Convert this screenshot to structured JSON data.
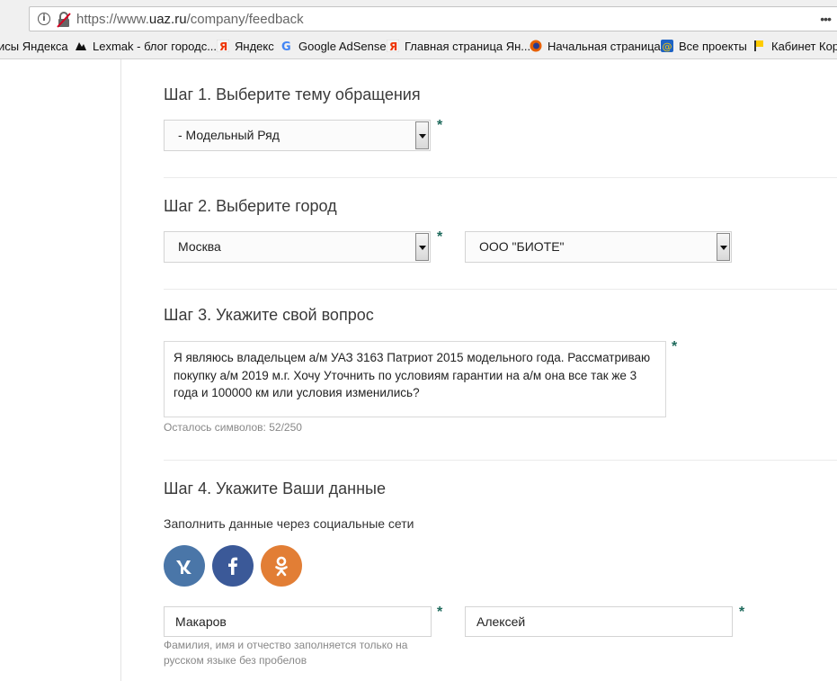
{
  "browser": {
    "url_prefix": "https://www.",
    "url_domain": "uaz.ru",
    "url_path": "/company/feedback",
    "menu_glyph": "•••",
    "bookmarks": [
      {
        "label": "исы Яндекса",
        "icon": "none"
      },
      {
        "label": "Lexmak - блог городс...",
        "icon": "lexmak-icon"
      },
      {
        "label": "Яндекс",
        "icon": "yandex-icon"
      },
      {
        "label": "Google AdSense",
        "icon": "google-icon"
      },
      {
        "label": "Главная страница Ян...",
        "icon": "yandex-icon"
      },
      {
        "label": "Начальная страница",
        "icon": "firefox-icon"
      },
      {
        "label": "Все проекты",
        "icon": "at-icon"
      },
      {
        "label": "Кабинет Корп",
        "icon": "yandex-flag-icon"
      }
    ]
  },
  "step1": {
    "title": "Шаг 1. Выберите тему обращения",
    "topic_select": "- Модельный Ряд",
    "required_mark": "*"
  },
  "step2": {
    "title": "Шаг 2. Выберите город",
    "city_select": "Москва",
    "dealer_select": "ООО \"БИОТЕ\"",
    "required_mark": "*"
  },
  "step3": {
    "title": "Шаг 3. Укажите свой вопрос",
    "question_text": "Я являюсь владельцем а/м УАЗ 3163 Патриот 2015 модельного года. Рассматриваю покупку а/м 2019 м.г. Хочу Уточнить по условиям гарантии на а/м она все так же 3 года и 100000 км или условия изменились?",
    "chars_left": "Осталось символов: 52/250",
    "required_mark": "*"
  },
  "step4": {
    "title": "Шаг 4. Укажите Ваши данные",
    "social_label": "Заполнить данные через социальные сети",
    "social": [
      {
        "name": "vk",
        "glyph": "вк",
        "color": "#4a76a8"
      },
      {
        "name": "facebook",
        "glyph": "f",
        "color": "#3b5998"
      },
      {
        "name": "odnoklassniki",
        "glyph": "ок",
        "color": "#e27e35"
      }
    ],
    "last_name": "Макаров",
    "first_name": "Алексей",
    "name_hint": "Фамилия, имя и отчество заполняется только на русском языке без пробелов",
    "required_mark": "*"
  }
}
